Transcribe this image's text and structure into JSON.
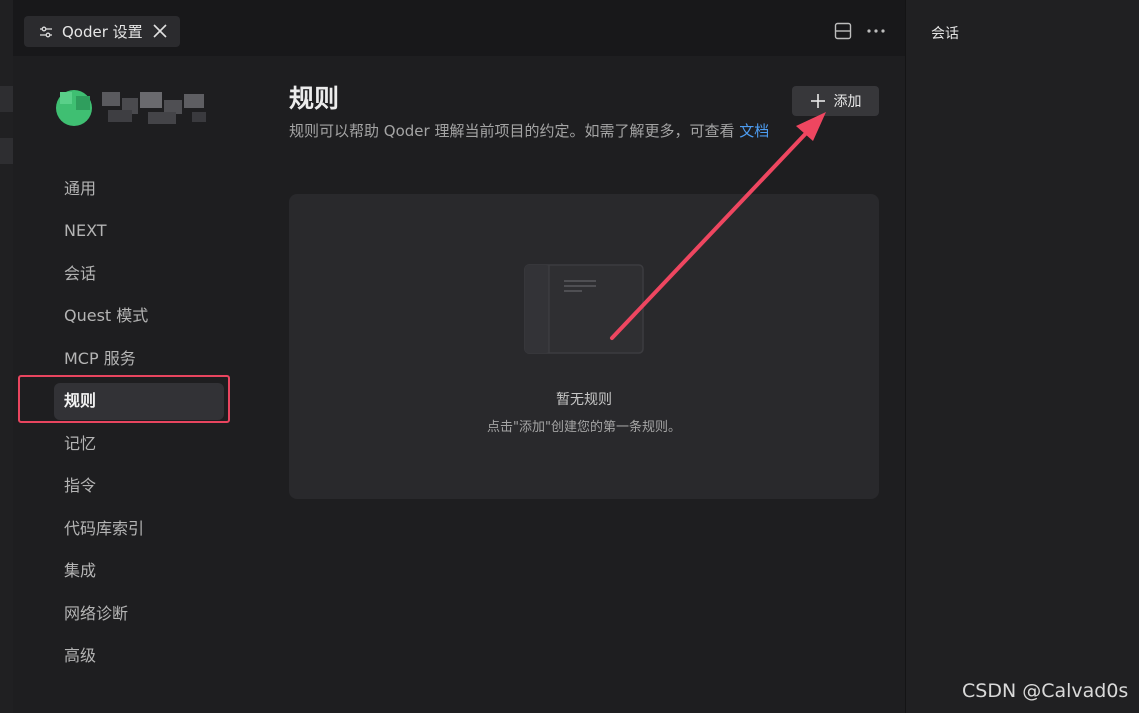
{
  "tab": {
    "icon": "sliders-icon",
    "title": "Qoder 设置",
    "close_icon": "close-icon"
  },
  "top_actions": {
    "layout_icon": "split-layout-icon",
    "more_icon": "more-icon"
  },
  "sidebar": {
    "items": [
      {
        "label": "通用"
      },
      {
        "label": "NEXT"
      },
      {
        "label": "会话"
      },
      {
        "label": "Quest 模式"
      },
      {
        "label": "MCP 服务"
      },
      {
        "label": "规则",
        "active": true
      },
      {
        "label": "记忆"
      },
      {
        "label": "指令"
      },
      {
        "label": "代码库索引"
      },
      {
        "label": "集成"
      },
      {
        "label": "网络诊断"
      },
      {
        "label": "高级"
      }
    ]
  },
  "main": {
    "title": "规则",
    "description": "规则可以帮助 Qoder 理解当前项目的约定。如需了解更多，可查看 ",
    "doc_link": "文档",
    "add_button_label": "添加",
    "empty_title": "暂无规则",
    "empty_hint": "点击\"添加\"创建您的第一条规则。"
  },
  "right_panel": {
    "title": "会话"
  },
  "watermark": "CSDN @Calvad0s",
  "colors": {
    "highlight": "#e9455f",
    "link": "#4d9cf0",
    "background": "#1e1e20"
  }
}
